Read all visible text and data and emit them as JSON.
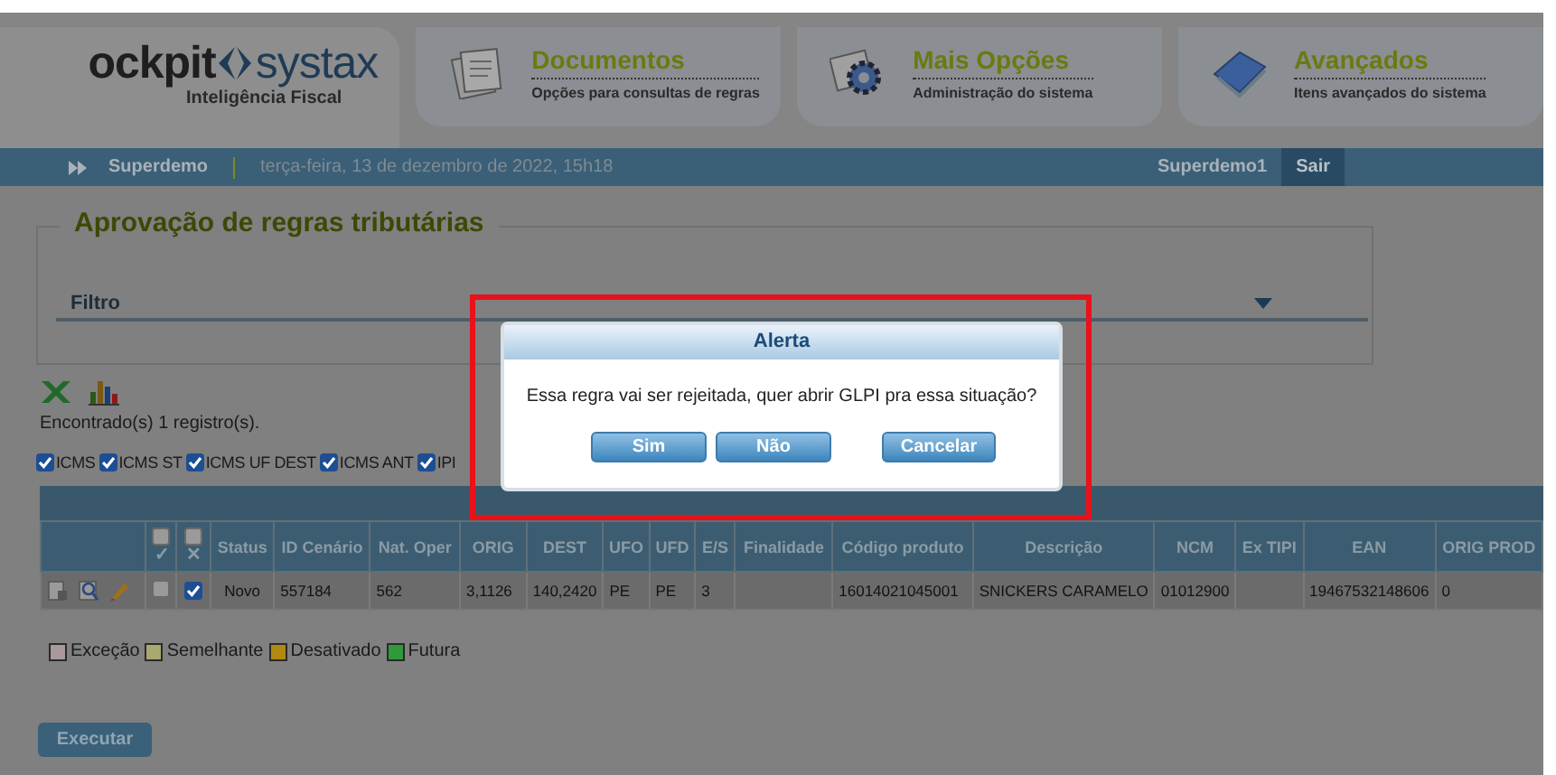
{
  "header": {
    "logo": {
      "text_a": "ockpit",
      "text_b": "systax",
      "tagline": "Inteligência Fiscal"
    },
    "tabs": [
      {
        "title": "Documentos",
        "subtitle": "Opções para consultas de regras",
        "kind": "documents"
      },
      {
        "title": "Mais Opções",
        "subtitle": "Administração do sistema",
        "kind": "gear"
      },
      {
        "title": "Avançados",
        "subtitle": "Itens avançados do sistema",
        "kind": "book"
      }
    ]
  },
  "user_bar": {
    "user": "Superdemo",
    "date": "terça-feira, 13 de dezembro de 2022, 15h18",
    "account": "Superdemo1",
    "logout": "Sair"
  },
  "panel": {
    "title": "Aprovação de regras tributárias",
    "filter": {
      "label": "Filtro",
      "expanded": false
    }
  },
  "result_count": "Encontrado(s) 1 registro(s).",
  "tax_filters": [
    {
      "label": "ICMS",
      "checked": true
    },
    {
      "label": "ICMS ST",
      "checked": true
    },
    {
      "label": "ICMS UF DEST",
      "checked": true
    },
    {
      "label": "ICMS ANT",
      "checked": true
    },
    {
      "label": "IPI",
      "checked": true
    }
  ],
  "table": {
    "header_checks": [
      {
        "symbol": "✓",
        "checked": false
      },
      {
        "symbol": "✕",
        "checked": false
      }
    ],
    "columns": [
      "Status",
      "ID Cenário",
      "Nat. Oper",
      "ORIG",
      "DEST",
      "UFO",
      "UFD",
      "E/S",
      "Finalidade",
      "Código produto",
      "Descrição",
      "NCM",
      "Ex TIPI",
      "EAN",
      "ORIG PROD"
    ],
    "rows": [
      {
        "approve": false,
        "reject": true,
        "cells": [
          "Novo",
          "557184",
          "562",
          "3,1126",
          "140,2420",
          "PE",
          "PE",
          "3",
          "",
          "16014021045001",
          "SNICKERS CARAMELO",
          "01012900",
          "",
          "19467532148606",
          "0"
        ]
      }
    ]
  },
  "legend": [
    {
      "label": "Exceção",
      "color": "#a89a9a"
    },
    {
      "label": "Semelhante",
      "color": "#a8a870"
    },
    {
      "label": "Desativado",
      "color": "#b08a10"
    },
    {
      "label": "Futura",
      "color": "#2e9a3a"
    }
  ],
  "execute_button": "Executar",
  "dialog": {
    "title": "Alerta",
    "message": "Essa regra vai ser rejeitada, quer abrir GLPI pra essa situação?",
    "buttons": [
      "Sim",
      "Não",
      "Cancelar"
    ]
  }
}
